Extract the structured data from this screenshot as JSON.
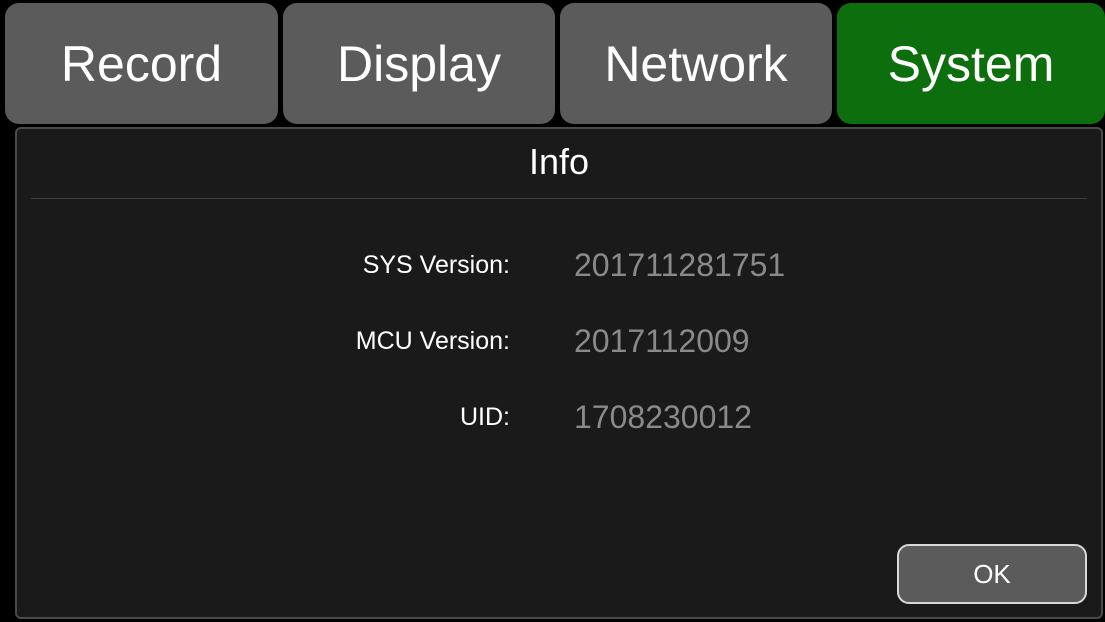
{
  "tabs": [
    {
      "label": "Record",
      "active": false
    },
    {
      "label": "Display",
      "active": false
    },
    {
      "label": "Network",
      "active": false
    },
    {
      "label": "System",
      "active": true
    }
  ],
  "panel": {
    "title": "Info",
    "rows": [
      {
        "label": "SYS Version:",
        "value": "201711281751"
      },
      {
        "label": "MCU Version:",
        "value": "2017112009"
      },
      {
        "label": "UID:",
        "value": "1708230012"
      }
    ],
    "ok_label": "OK"
  },
  "colors": {
    "active_tab": "#0d6e0d",
    "inactive_tab": "#5b5b5b",
    "panel_background": "#1a1a1a",
    "value_text": "#8a8a8a"
  }
}
